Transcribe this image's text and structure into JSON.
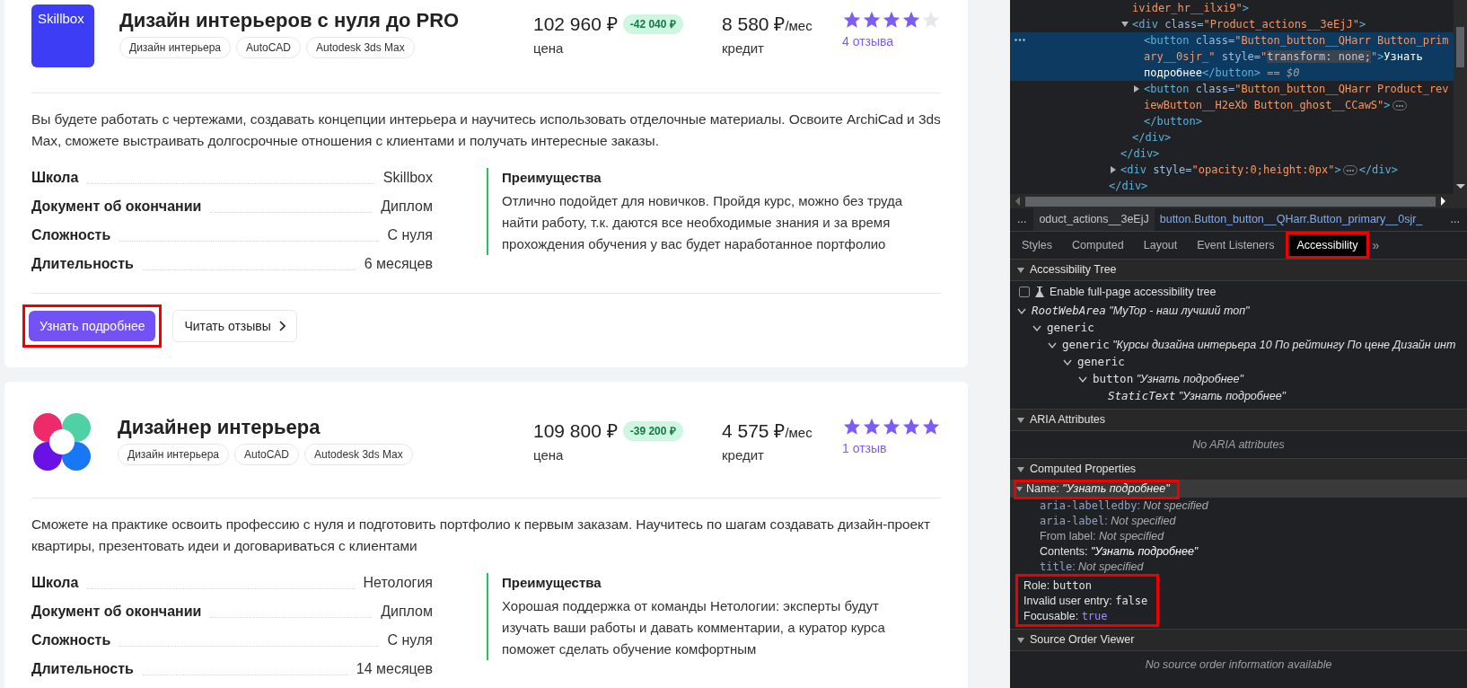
{
  "products": [
    {
      "logo": {
        "kind": "wordmark",
        "text": "Skillbox"
      },
      "title": "Дизайн интерьеров с нуля до PRO",
      "tags": [
        "Дизайн интерьера",
        "AutoCAD",
        "Autodesk 3ds Max"
      ],
      "price": "102 960 ₽",
      "discount": "-42 040 ₽",
      "price_label": "цена",
      "credit": "8 580 ₽",
      "credit_unit": "/мес",
      "credit_label": "кредит",
      "stars": 4,
      "reviews": "4 отзыва",
      "description": "Вы будете работать с чертежами, создавать концепции интерьера и научитесь использовать отделочные материалы. Освоите ArchiCad и 3ds Max, сможете выстраивать долгосрочные отношения с клиентами и получать интересные заказы.",
      "specs": [
        {
          "label": "Школа",
          "value": "Skillbox"
        },
        {
          "label": "Документ об окончании",
          "value": "Диплом"
        },
        {
          "label": "Сложность",
          "value": "С нуля"
        },
        {
          "label": "Длительность",
          "value": "6 месяцев"
        }
      ],
      "benefits_title": "Преимущества",
      "benefits_text": "Отлично подойдет для новичков. Пройдя курс, можно без труда найти работу, т.к. даются все необходимые знания и за время прохождения обучения у вас будет наработанное портфолио",
      "actions": {
        "primary": {
          "label": "Узнать подробнее",
          "annotated": true
        },
        "secondary": {
          "label": "Читать отзывы"
        }
      }
    },
    {
      "logo": {
        "kind": "petals"
      },
      "title": "Дизайнер интерьера",
      "tags": [
        "Дизайн интерьера",
        "AutoCAD",
        "Autodesk 3ds Max"
      ],
      "price": "109 800 ₽",
      "discount": "-39 200 ₽",
      "price_label": "цена",
      "credit": "4 575 ₽",
      "credit_unit": "/мес",
      "credit_label": "кредит",
      "stars": 5,
      "reviews": "1 отзыв",
      "description": "Сможете на практике освоить профессию с нуля и подготовить портфолио к первым заказам. Научитесь по шагам создавать дизайн-проект квартиры, презентовать идеи и договариваться с клиентами",
      "specs": [
        {
          "label": "Школа",
          "value": "Нетология"
        },
        {
          "label": "Документ об окончании",
          "value": "Диплом"
        },
        {
          "label": "Сложность",
          "value": "С нуля"
        },
        {
          "label": "Длительность",
          "value": "14 месяцев"
        }
      ],
      "benefits_title": "Преимущества",
      "benefits_text": "Хорошая поддержка от команды Нетологии: эксперты будут изучать ваши работы и давать комментарии, а куратор курса поможет сделать обучение комфортным"
    }
  ],
  "elements_tree": [
    {
      "close": [
        {
          "kind": "tag",
          "text": "</div>"
        }
      ],
      "children": [
        {
          "close": [
            {
              "kind": "tag",
              "text": "</div>"
            }
          ],
          "children": [
            {
              "open": [
                {
                  "kind": "value",
                  "text": "ivider_hr__ilxi9\""
                },
                {
                  "kind": "tag",
                  "text": ">"
                }
              ]
            },
            {
              "expanded": true,
              "open": [
                {
                  "kind": "tag",
                  "text": "<div"
                },
                {
                  "kind": "attr",
                  "text": " class="
                },
                {
                  "kind": "value",
                  "text": "\"Product_actions__3eEjJ\""
                },
                {
                  "kind": "tag",
                  "text": ">"
                }
              ],
              "close": [
                {
                  "kind": "tag",
                  "text": "</div>"
                }
              ],
              "children": [
                {
                  "selected": true,
                  "open": [
                    {
                      "kind": "tag",
                      "text": "<button"
                    },
                    {
                      "kind": "attr",
                      "text": " class="
                    },
                    {
                      "kind": "value",
                      "text": "\"Button_button__QHarr Button_primary__0sjr_\""
                    },
                    {
                      "kind": "attr",
                      "text": " style="
                    },
                    {
                      "kind": "value",
                      "text": "\""
                    },
                    {
                      "kind": "css",
                      "text": "transform: none;"
                    },
                    {
                      "kind": "value",
                      "text": "\""
                    },
                    {
                      "kind": "tag",
                      "text": ">"
                    },
                    {
                      "kind": "text",
                      "text": "Узнать подробнее"
                    },
                    {
                      "kind": "tag",
                      "text": "</button>"
                    },
                    {
                      "kind": "ref",
                      "text": " == $0"
                    }
                  ]
                },
                {
                  "selected": false,
                  "expanded": false,
                  "open": [
                    {
                      "kind": "tag",
                      "text": "<button"
                    },
                    {
                      "kind": "attr",
                      "text": " class="
                    },
                    {
                      "kind": "value",
                      "text": "\"Button_button__QHarr Product_reviewButton__H2eXb Button_ghost__CCawS\""
                    },
                    {
                      "kind": "tag",
                      "text": ">"
                    },
                    {
                      "kind": "more"
                    }
                  ],
                  "close": [
                    {
                      "kind": "tag",
                      "text": "</button>"
                    }
                  ]
                }
              ]
            }
          ]
        },
        {
          "expanded": false,
          "open": [
            {
              "kind": "tag",
              "text": "<div"
            },
            {
              "kind": "attr",
              "text": " style="
            },
            {
              "kind": "value",
              "text": "\"opacity:0;height:0px\""
            },
            {
              "kind": "tag",
              "text": ">"
            },
            {
              "kind": "more"
            },
            {
              "kind": "tag",
              "text": "</div>"
            }
          ]
        }
      ]
    }
  ],
  "breadcrumbs": {
    "leading": "...",
    "items": [
      {
        "text": "oduct_actions__3eEjJ",
        "selected": false
      },
      {
        "text": "button.Button_button__QHarr.Button_primary__0sjr_",
        "selected": true
      }
    ],
    "trailing": "..."
  },
  "panel_tabs": {
    "items": [
      {
        "label": "Styles",
        "selected": false
      },
      {
        "label": "Computed",
        "selected": false
      },
      {
        "label": "Layout",
        "selected": false
      },
      {
        "label": "Event Listeners",
        "selected": false
      },
      {
        "label": "Accessibility",
        "selected": true,
        "annotated": true
      }
    ],
    "overflow": "»"
  },
  "accessibility": {
    "tree_section": {
      "title": "Accessibility Tree",
      "expanded": true,
      "checkbox": {
        "label": "Enable full-page accessibility tree",
        "checked": false
      },
      "nodes": [
        {
          "role": "RootWebArea",
          "name": "\"MyTop - наш лучший топ\"",
          "italic": true,
          "expanded": true,
          "children": [
            {
              "role": "generic",
              "italic": false,
              "expanded": true,
              "children": [
                {
                  "role": "generic",
                  "name": "\"Курсы дизайна интерьера 10 По рейтингу По цене Дизайн инт",
                  "italic": false,
                  "expanded": true,
                  "children": [
                    {
                      "role": "generic",
                      "italic": false,
                      "expanded": true,
                      "children": [
                        {
                          "role": "button",
                          "name": "\"Узнать подробнее\"",
                          "italic": false,
                          "expanded": true,
                          "children": [
                            {
                              "role": "StaticText",
                              "name": "\"Узнать подробнее\"",
                              "italic": true
                            }
                          ]
                        }
                      ]
                    }
                  ]
                }
              ]
            }
          ]
        }
      ]
    },
    "aria_section": {
      "title": "ARIA Attributes",
      "expanded": true,
      "empty_text": "No ARIA attributes"
    },
    "computed_section": {
      "title": "Computed Properties",
      "expanded": true,
      "name_row": {
        "label": "Name:",
        "value": "\"Узнать подробнее\"",
        "expanded": true,
        "annotated": true
      },
      "sources": [
        {
          "kind": "attr",
          "key": "aria-labelledby",
          "separator": ":",
          "value": "Not specified",
          "set": false
        },
        {
          "kind": "attr",
          "key": "aria-label",
          "separator": ":",
          "value": "Not specified",
          "set": false
        },
        {
          "kind": "label",
          "key": "From label",
          "separator": ":",
          "value": "Not specified",
          "set": false
        },
        {
          "kind": "label",
          "key": "Contents",
          "separator": ":",
          "value": "\"Узнать подробнее\"",
          "set": true
        },
        {
          "kind": "attr",
          "key": "title",
          "separator": ":",
          "value": "Not specified",
          "set": false
        }
      ],
      "properties_annotated": true,
      "properties": [
        {
          "key": "Role:",
          "value": "button",
          "accent": false
        },
        {
          "key": "Invalid user entry:",
          "value": "false",
          "accent": false
        },
        {
          "key": "Focusable:",
          "value": "true",
          "accent": true
        }
      ]
    },
    "source_order_section": {
      "title": "Source Order Viewer",
      "expanded": true,
      "empty_text": "No source order information available"
    }
  }
}
